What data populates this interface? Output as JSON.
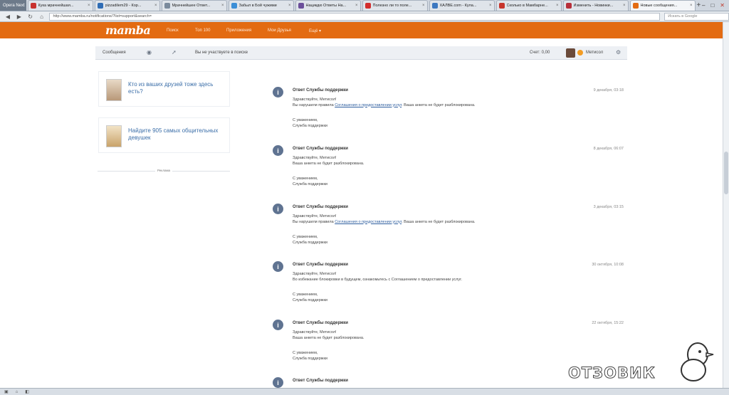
{
  "browser": {
    "app_label": "Opera Next",
    "tabs": [
      {
        "label": "Кука мрачнейшая...",
        "color": "#c8312e",
        "active": false
      },
      {
        "label": "pizzadilem29 - Кор...",
        "color": "#2f6db5",
        "active": false
      },
      {
        "label": "Мрачнейшее Ответ...",
        "color": "#7a8a9c",
        "active": false
      },
      {
        "label": "Забыл в Бой чужими",
        "color": "#3b8ed6",
        "active": false
      },
      {
        "label": "Нацикдю Ответы На...",
        "color": "#6b4f9a",
        "active": false
      },
      {
        "label": "Полезно ли то поле...",
        "color": "#d22d2d",
        "active": false
      },
      {
        "label": "ХАЛВЕ.com - Кула...",
        "color": "#3c78c0",
        "active": false
      },
      {
        "label": "Сколько в Мамбарне...",
        "color": "#c7352d",
        "active": false
      },
      {
        "label": "Изменить - Новинки...",
        "color": "#b72f3a",
        "active": false
      },
      {
        "label": "Новые сообщения...",
        "color": "#e36b12",
        "active": true
      }
    ],
    "url": "http://www.mamba.ru/notifications/?list=support&search=",
    "search_placeholder": "Искать в Google"
  },
  "site": {
    "logo": "mamba",
    "nav": [
      "Поиск",
      "Топ 100",
      "Приложения",
      "Мои Друзья",
      "Ещё ▾"
    ]
  },
  "subbar": {
    "messages_label": "Сообщения",
    "status_text": "Вы не участвуете в поиске",
    "balance": "Счет: 0,00",
    "user": "Метисол"
  },
  "sidebar": {
    "cards": [
      {
        "text": "Кто из ваших друзей тоже здесь есть?"
      },
      {
        "text": "Найдите 905 самых общительных девушек"
      }
    ],
    "divider_label": "Реклама"
  },
  "messages": [
    {
      "from": "Ответ Службы поддержки",
      "date": "9 декабря, 03:18",
      "greeting": "Здравствуйте, Метисол!",
      "line_pre": "Вы нарушили правила",
      "link": "Соглашения о предоставлении услуг",
      "line_post": ". Ваша анкета не будет разблокирована.",
      "sig1": "С уважением,",
      "sig2": "Служба поддержки"
    },
    {
      "from": "Ответ Службы поддержки",
      "date": "8 декабря, 06:07",
      "greeting": "Здравствуйте, Метисол!",
      "line_pre": "Ваша анкета не будет разблокирована.",
      "link": "",
      "line_post": "",
      "sig1": "С уважением,",
      "sig2": "Служба поддержки"
    },
    {
      "from": "Ответ Службы поддержки",
      "date": "3 декабря, 03:15",
      "greeting": "Здравствуйте, Метисол!",
      "line_pre": "Вы нарушили правила",
      "link": "Соглашения о предоставлении услуг",
      "line_post": ". Ваша анкета не будет разблокирована.",
      "sig1": "С уважением,",
      "sig2": "Служба поддержки"
    },
    {
      "from": "Ответ Службы поддержки",
      "date": "30 октября, 10:08",
      "greeting": "Здравствуйте, Метисол!",
      "line_pre": "Во избежание блокировки в будущем, ознакомьтесь с Соглашением о предоставлении услуг.",
      "link": "",
      "line_post": "",
      "sig1": "С уважением,",
      "sig2": "Служба поддержки"
    },
    {
      "from": "Ответ Службы поддержки",
      "date": "22 октября, 15:22",
      "greeting": "Здравствуйте, Метисол!",
      "line_pre": "Ваша анкета не будет разблокирована.",
      "link": "",
      "line_post": "",
      "sig1": "С уважением,",
      "sig2": "Служба поддержки"
    },
    {
      "from": "Ответ Службы поддержки",
      "date": "",
      "greeting": "",
      "line_pre": "",
      "link": "",
      "line_post": "",
      "sig1": "",
      "sig2": ""
    }
  ],
  "watermark": "ОТЗОВИК"
}
